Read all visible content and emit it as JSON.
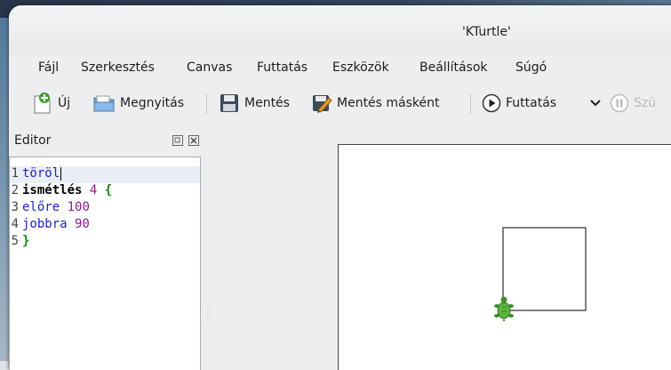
{
  "window": {
    "title": "'KTurtle'"
  },
  "menubar": {
    "items": [
      "Fájl",
      "Szerkesztés",
      "Canvas",
      "Futtatás",
      "Eszközök",
      "Beállítások",
      "Súgó"
    ]
  },
  "toolbar": {
    "new_label": "Új",
    "open_label": "Megnyitás",
    "save_label": "Mentés",
    "save_as_label": "Mentés másként",
    "run_label": "Futtatás",
    "pause_label": "Szü"
  },
  "editor": {
    "title": "Editor",
    "lines": [
      {
        "num": "1",
        "parts": [
          {
            "text": "töröl",
            "color": "#1f1fbf",
            "bold": false
          }
        ]
      },
      {
        "num": "2",
        "parts": [
          {
            "text": "ismétlés",
            "color": "#000000",
            "bold": true
          },
          {
            "text": " 4 ",
            "color": "#8b1a8b",
            "bold": false
          },
          {
            "text": "{",
            "color": "#138a13",
            "bold": true
          }
        ]
      },
      {
        "num": "3",
        "parts": [
          {
            "text": "előre",
            "color": "#1f1fbf",
            "bold": false
          },
          {
            "text": " 100",
            "color": "#8b1a8b",
            "bold": false
          }
        ]
      },
      {
        "num": "4",
        "parts": [
          {
            "text": "jobbra",
            "color": "#1f1fbf",
            "bold": false
          },
          {
            "text": " 90",
            "color": "#8b1a8b",
            "bold": false
          }
        ]
      },
      {
        "num": "5",
        "parts": [
          {
            "text": "}",
            "color": "#138a13",
            "bold": true
          }
        ]
      }
    ]
  },
  "colors": {
    "accent": "#2f7bd6",
    "line_highlight": "#e9eef7",
    "keyword": "#1f1fbf",
    "number": "#8b1a8b",
    "brace": "#138a13"
  }
}
